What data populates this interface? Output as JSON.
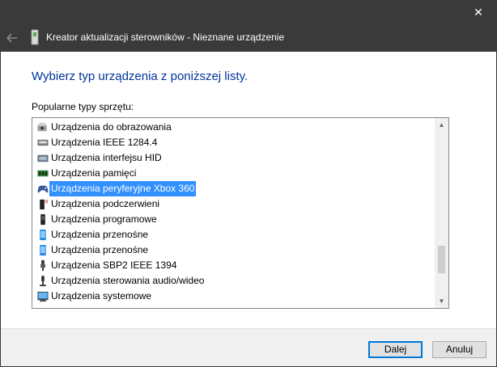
{
  "window": {
    "title": "Kreator aktualizacji sterowników - Nieznane urządzenie",
    "close_glyph": "✕"
  },
  "heading": "Wybierz typ urządzenia z poniższej listy.",
  "list_caption": "Popularne typy sprzętu:",
  "device_types": [
    {
      "label": "Urządzenia do obrazowania",
      "icon": "imaging-device-icon"
    },
    {
      "label": "Urządzenia IEEE 1284.4",
      "icon": "ieee-1284-device-icon"
    },
    {
      "label": "Urządzenia interfejsu HID",
      "icon": "hid-device-icon"
    },
    {
      "label": "Urządzenia pamięci",
      "icon": "memory-device-icon"
    },
    {
      "label": "Urządzenia peryferyjne Xbox 360",
      "icon": "gamepad-icon"
    },
    {
      "label": "Urządzenia podczerwieni",
      "icon": "infrared-device-icon"
    },
    {
      "label": "Urządzenia programowe",
      "icon": "software-device-icon"
    },
    {
      "label": "Urządzenia przenośne",
      "icon": "portable-device-icon"
    },
    {
      "label": "Urządzenia przenośne",
      "icon": "portable-device-icon"
    },
    {
      "label": "Urządzenia SBP2 IEEE 1394",
      "icon": "sbp2-device-icon"
    },
    {
      "label": "Urządzenia sterowania audio/wideo",
      "icon": "av-control-icon"
    },
    {
      "label": "Urządzenia systemowe",
      "icon": "system-device-icon"
    }
  ],
  "selected_index": 4,
  "buttons": {
    "next": "Dalej",
    "cancel": "Anuluj"
  },
  "colors": {
    "titlebar": "#3a3a3a",
    "heading": "#003399",
    "selection": "#3390ff",
    "default_button_border": "#0078d7"
  }
}
